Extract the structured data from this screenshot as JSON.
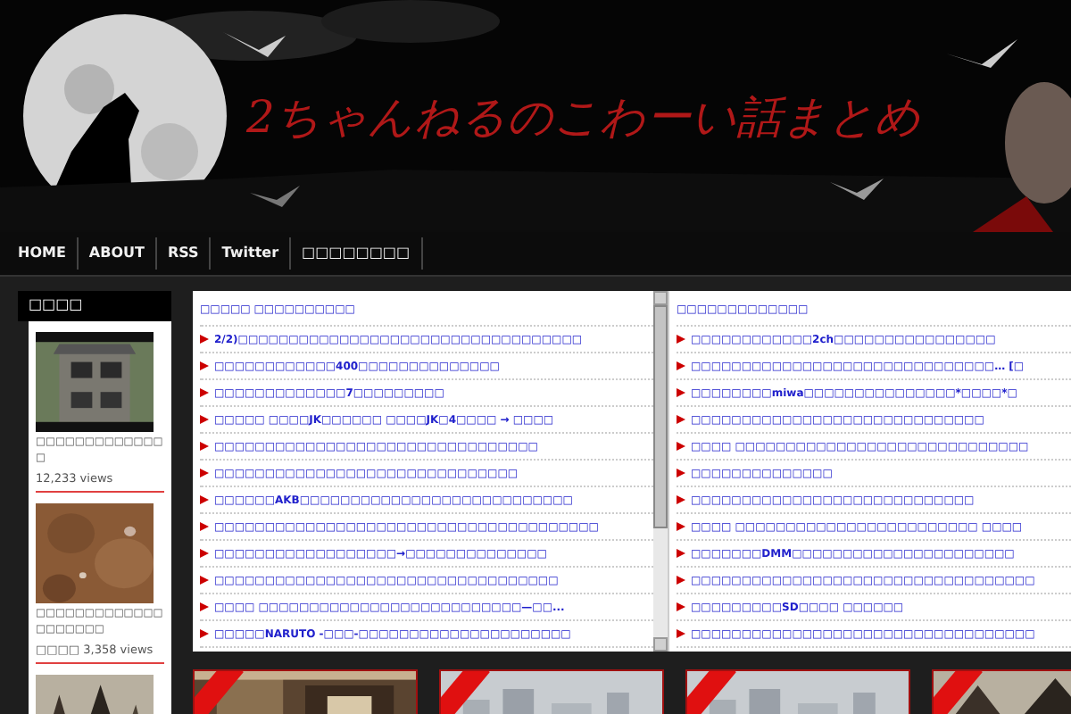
{
  "header": {
    "title": "2ちゃんねるのこわーい話まとめ"
  },
  "nav": [
    {
      "label": "HOME"
    },
    {
      "label": "ABOUT"
    },
    {
      "label": "RSS"
    },
    {
      "label": "Twitter"
    },
    {
      "label": "□□□□□□□□"
    }
  ],
  "sidebar": {
    "heading": "□□□□",
    "posts": [
      {
        "title": "□□□□□□□□□□□□□□",
        "views": "12,233 views",
        "kind": "house"
      },
      {
        "title": "□□□□□□□□□□□□□□□□□□□□",
        "views": "□□□□ 3,358 views",
        "kind": "texture"
      },
      {
        "kind": "trees"
      }
    ]
  },
  "feeds": [
    {
      "title": "□□□□□ □□□□□□□□□□",
      "items": [
        "2/2)□□□□□□□□□□□□□□□□□□□□□□□□□□□□□□□□□□",
        "□□□□□□□□□□□□400□□□□□□□□□□□□□□",
        "□□□□□□□□□□□□□7□□□□□□□□□",
        "□□□□□ □□□□JK□□□□□□ □□□□JK□4□□□□ → □□□□",
        "□□□□□□□□□□□□□□□□□□□□□□□□□□□□□□□□",
        "□□□□□□□□□□□□□□□□□□□□□□□□□□□□□□",
        "□□□□□□AKB□□□□□□□□□□□□□□□□□□□□□□□□□□□",
        "□□□□□□□□□□□□□□□□□□□□□□□□□□□□□□□□□□□□□□",
        "□□□□□□□□□□□□□□□□□□→□□□□□□□□□□□□□□",
        "□□□□□□□□□□□□□□□□□□□□□□□□□□□□□□□□□□",
        "□□□□ □□□□□□□□□□□□□□□□□□□□□□□□□□—□□...",
        "□□□□□NARUTO -□□□-□□□□□□□□□□□□□□□□□□□□□"
      ]
    },
    {
      "title": "□□□□□□□□□□□□□",
      "items": [
        "□□□□□□□□□□□□2ch□□□□□□□□□□□□□□□□",
        "□□□□□□□□□□□□□□□□□□□□□□□□□□□□□□… [□",
        "□□□□□□□□miwa□□□□□□□□□□□□□□□*□□□□*□",
        "□□□□□□□□□□□□□□□□□□□□□□□□□□□□□",
        "□□□□ □□□□□□□□□□□□□□□□□□□□□□□□□□□□□",
        "□□□□□□□□□□□□□□",
        "□□□□□□□□□□□□□□□□□□□□□□□□□□□□",
        "□□□□ □□□□□□□□□□□□□□□□□□□□□□□□ □□□□",
        "□□□□□□□DMM□□□□□□□□□□□□□□□□□□□□□□",
        "□□□□□□□□□□□□□□□□□□□□□□□□□□□□□□□□□□",
        "□□□□□□□□□SD□□□□ □□□□□□",
        "□□□□□□□□□□□□□□□□□□□□□□□□□□□□□□□□□□"
      ]
    }
  ],
  "gallery": [
    {
      "kind": "interior"
    },
    {
      "kind": "city"
    },
    {
      "kind": "city"
    },
    {
      "kind": "trees"
    }
  ]
}
